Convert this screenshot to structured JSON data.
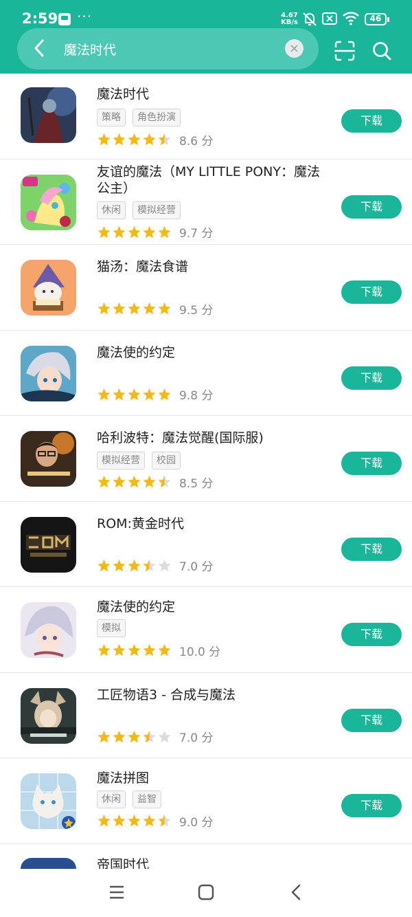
{
  "status_bar": {
    "time": "2:59",
    "more": "···",
    "net_speed_value": "4.67",
    "net_speed_unit": "KB/s",
    "battery": "46"
  },
  "search": {
    "query": "魔法时代"
  },
  "colors": {
    "accent": "#1ab59a",
    "star_on": "#f5b916",
    "star_off": "#dcdcdc"
  },
  "apps": [
    {
      "name": "魔法时代",
      "tags": [
        "策略",
        "角色扮演"
      ],
      "stars": 4.5,
      "score": "8.6 分",
      "action": "下载"
    },
    {
      "name": "友谊的魔法（MY LITTLE PONY：魔法公主）",
      "tags": [
        "休闲",
        "模拟经营"
      ],
      "stars": 5,
      "score": "9.7 分",
      "action": "下载"
    },
    {
      "name": "猫汤：魔法食谱",
      "tags": [],
      "stars": 5,
      "score": "9.5 分",
      "action": "下载"
    },
    {
      "name": "魔法使的约定",
      "tags": [],
      "stars": 5,
      "score": "9.8 分",
      "action": "下载"
    },
    {
      "name": "哈利波特：魔法觉醒(国际服)",
      "tags": [
        "模拟经营",
        "校园"
      ],
      "stars": 4.5,
      "score": "8.5 分",
      "action": "下载"
    },
    {
      "name": "ROM:黄金时代",
      "tags": [],
      "stars": 3.5,
      "score": "7.0 分",
      "action": "下载"
    },
    {
      "name": "魔法使的约定",
      "tags": [
        "模拟"
      ],
      "stars": 5,
      "score": "10.0 分",
      "action": "下载"
    },
    {
      "name": "工匠物语3 - 合成与魔法",
      "tags": [],
      "stars": 3.5,
      "score": "7.0 分",
      "action": "下载"
    },
    {
      "name": "魔法拼图",
      "tags": [
        "休闲",
        "益智"
      ],
      "stars": 4.5,
      "score": "9.0 分",
      "action": "下载"
    }
  ],
  "partial_item": {
    "name": "帝国时代"
  },
  "nav": [
    "menu-icon",
    "home-icon",
    "back-icon"
  ]
}
